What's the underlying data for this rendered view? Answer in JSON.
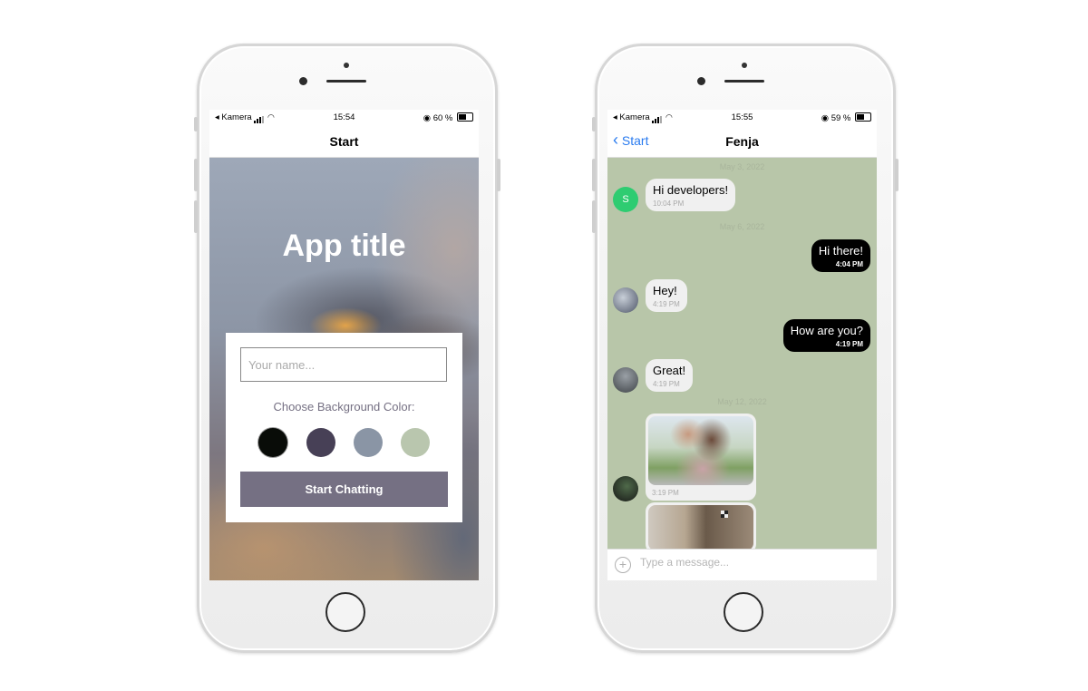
{
  "phone1": {
    "status": {
      "carrier": "◂ Kamera",
      "time": "15:54",
      "battery": "60 %",
      "battery_level": 0.6
    },
    "nav_title": "Start",
    "app_title": "App title",
    "name_placeholder": "Your name...",
    "choose_label": "Choose Background Color:",
    "colors": [
      "#090C08",
      "#474056",
      "#8A95A5",
      "#B9C6AE"
    ],
    "start_button": "Start Chatting"
  },
  "phone2": {
    "status": {
      "carrier": "◂ Kamera",
      "time": "15:55",
      "battery": "59 %",
      "battery_level": 0.59
    },
    "back_label": "Start",
    "nav_title": "Fenja",
    "background": "#B9C6AE",
    "dates": [
      "May 3, 2022",
      "May 6, 2022",
      "May 12, 2022"
    ],
    "messages": [
      {
        "side": "left",
        "text": "Hi developers!",
        "time": "10:04 PM",
        "avatar_letter": "S"
      },
      {
        "side": "right",
        "text": "Hi there!",
        "time": "4:04 PM"
      },
      {
        "side": "left",
        "text": "Hey!",
        "time": "4:19 PM"
      },
      {
        "side": "right",
        "text": "How are you?",
        "time": "4:19 PM"
      },
      {
        "side": "left",
        "text": "Great!",
        "time": "4:19 PM"
      },
      {
        "side": "left",
        "image": "family-photo",
        "time": "3:19 PM"
      },
      {
        "side": "left",
        "image": "room-photo"
      }
    ],
    "composer_placeholder": "Type a message..."
  }
}
